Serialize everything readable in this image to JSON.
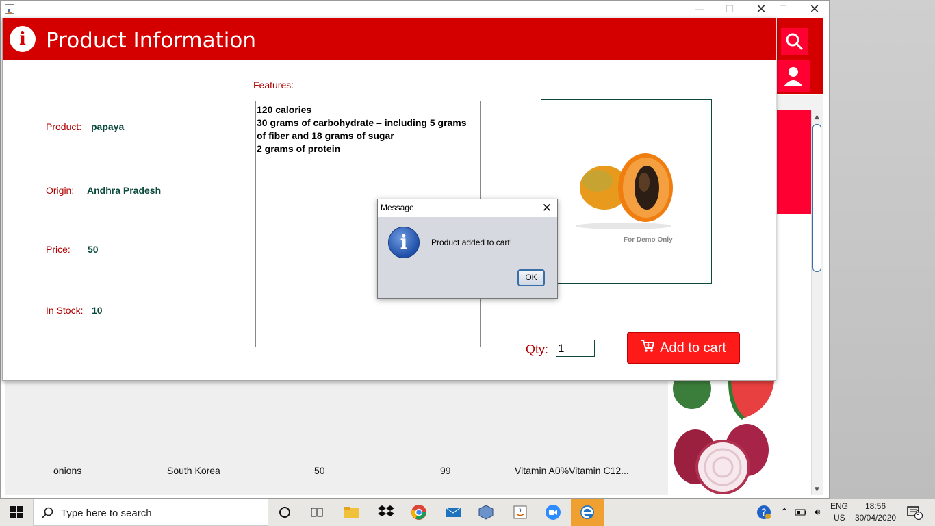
{
  "background_window": {
    "table_row": {
      "product": "onions",
      "origin": "South Korea",
      "price": "50",
      "stock": "99",
      "features": "Vitamin A0%Vitamin C12..."
    }
  },
  "product_window": {
    "title": "Product Information",
    "product_label": "Product:",
    "product_value": "papaya",
    "origin_label": "Origin:",
    "origin_value": "Andhra Pradesh",
    "price_label": "Price:",
    "price_value": "50",
    "stock_label": "In Stock:",
    "stock_value": "10",
    "features_label": "Features:",
    "features_text": "120 calories\n30 grams of carbohydrate – including 5 grams\nof fiber and 18 grams of sugar\n2 grams of protein",
    "image_caption": "For Demo Only",
    "qty_label": "Qty:",
    "qty_value": "1",
    "add_to_cart_label": "Add to cart"
  },
  "dialog": {
    "title": "Message",
    "message": "Product added to cart!",
    "ok_label": "OK"
  },
  "taskbar": {
    "search_placeholder": "Type here to search",
    "language_line1": "ENG",
    "language_line2": "US",
    "time": "18:56",
    "date": "30/04/2020",
    "notification_count": "5"
  },
  "colors": {
    "header_red": "#d40000",
    "button_red": "#ff1a1a",
    "label_red": "#b00000",
    "value_green": "#0b4a3c"
  }
}
